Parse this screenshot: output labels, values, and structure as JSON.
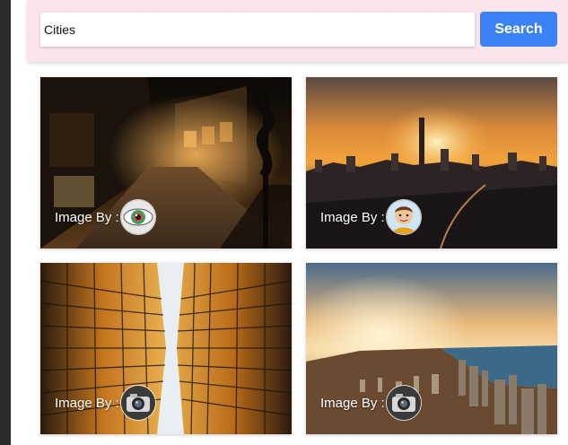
{
  "search": {
    "value": "Cities",
    "button_label": "Search"
  },
  "gallery": {
    "cards": [
      {
        "scene": "night-cobblestone-street",
        "credit_label": "Image By :",
        "avatar_icon": "eye-avatar-icon"
      },
      {
        "scene": "sunset-city-skyline",
        "credit_label": "Image By :",
        "avatar_icon": "child-portrait-avatar-icon"
      },
      {
        "scene": "glass-skyscrapers-looking-up",
        "credit_label": "Image By :",
        "avatar_icon": "camera-avatar-icon"
      },
      {
        "scene": "coastal-city-aerial",
        "credit_label": "Image By :",
        "avatar_icon": "camera-avatar-icon"
      }
    ]
  },
  "colors": {
    "panel_bg": "#fce4ec",
    "button_bg": "#3b82f6",
    "button_text": "#ffffff"
  }
}
